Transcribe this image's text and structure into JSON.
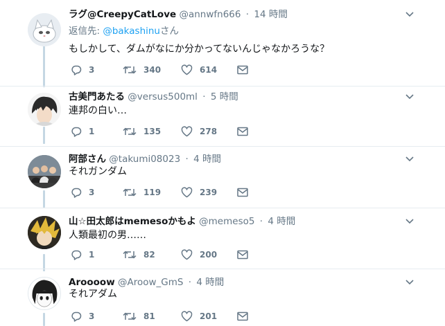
{
  "tweets": [
    {
      "name": "ラグ@CreepyCatLove",
      "handle": "@annwfn666",
      "sep": "·",
      "time": "14 時間",
      "reply_prefix": "返信先: ",
      "reply_mention": "@bakashinu",
      "reply_suffix": "さん",
      "text": "もしかして、ダムがなにか分かってないんじゃなかろうな？",
      "replies": "3",
      "retweets": "340",
      "likes": "614",
      "avatar_icon": "cat-avatar"
    },
    {
      "name": "古美門あたる",
      "handle": "@versus500ml",
      "sep": "·",
      "time": "5 時間",
      "text": "連邦の白い…",
      "replies": "1",
      "retweets": "135",
      "likes": "278",
      "avatar_icon": "anime-character-avatar"
    },
    {
      "name": "阿部さん",
      "handle": "@takumi08023",
      "sep": "·",
      "time": "4 時間",
      "text": "それガンダム",
      "replies": "3",
      "retweets": "119",
      "likes": "239",
      "avatar_icon": "group-photo-avatar"
    },
    {
      "name": "山☆田太郎はmemesoかもよ",
      "handle": "@memeso5",
      "sep": "·",
      "time": "4 時間",
      "text": "人類最初の男……",
      "replies": "1",
      "retweets": "82",
      "likes": "200",
      "avatar_icon": "anime-character-avatar"
    },
    {
      "name": "Aroooow",
      "handle": "@Aroow_GmS",
      "sep": "·",
      "time": "4 時間",
      "text": "それアダム",
      "replies": "3",
      "retweets": "81",
      "likes": "201",
      "avatar_icon": "anime-character-avatar"
    }
  ],
  "colors": {
    "thread_line": "#c5d7e3",
    "mention": "#1da1f2",
    "muted": "#657786",
    "divider": "#e6ecf0"
  }
}
